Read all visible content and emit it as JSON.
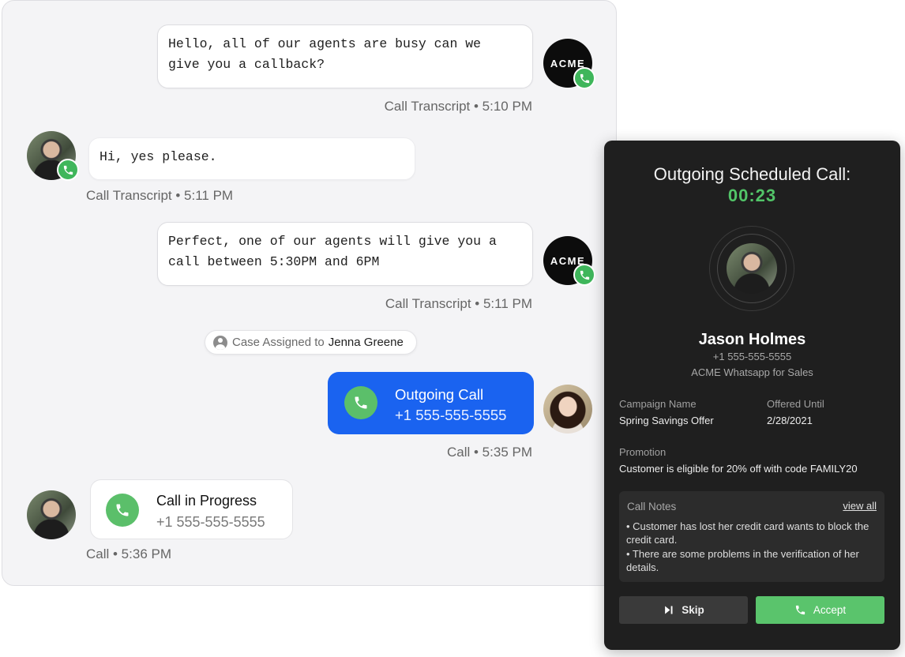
{
  "chat": {
    "messages": [
      {
        "text_line1": "Hello, all of our agents are busy can we",
        "text_line2": "give you a callback?",
        "meta": "Call Transcript • 5:10 PM",
        "sender_avatar": "ACME"
      },
      {
        "text_line1": "Hi, yes please.",
        "meta": "Call Transcript • 5:11 PM"
      },
      {
        "text_line1": "Perfect, one of our agents will give you a",
        "text_line2": "call between 5:30PM and 6PM",
        "meta": "Call Transcript • 5:11 PM",
        "sender_avatar": "ACME"
      }
    ],
    "case_assigned": {
      "prefix": "Case Assigned to",
      "name": "Jenna Greene"
    },
    "outgoing_call": {
      "title": "Outgoing Call",
      "number": "+1 555-555-5555",
      "meta": "Call •  5:35 PM"
    },
    "call_in_progress": {
      "title": "Call in Progress",
      "number": "+1 555-555-5555",
      "meta": "Call • 5:36 PM"
    }
  },
  "call_card": {
    "heading": "Outgoing Scheduled Call:",
    "timer": "00:23",
    "contact_name": "Jason Holmes",
    "contact_phone": "+1 555-555-5555",
    "line": "ACME Whatsapp for Sales",
    "campaign_label": "Campaign Name",
    "campaign_value": "Spring Savings Offer",
    "offered_label": "Offered Until",
    "offered_value": "2/28/2021",
    "promotion_label": "Promotion",
    "promotion_value": "Customer is eligible for 20% off with code FAMILY20",
    "notes": {
      "title": "Call Notes",
      "view_all": "view all",
      "items": [
        "• Customer has lost her credit card wants to block the credit card.",
        "• There are some problems in the verification of her details."
      ]
    },
    "skip_label": "Skip",
    "accept_label": "Accept"
  },
  "colors": {
    "accent_blue": "#1a63f0",
    "whatsapp_green": "#3fb65b",
    "timer_green": "#52c468",
    "card_bg": "#1f1f1f"
  },
  "icons": [
    "whatsapp-phone-icon",
    "phone-icon",
    "person-icon",
    "skip-next-icon"
  ]
}
